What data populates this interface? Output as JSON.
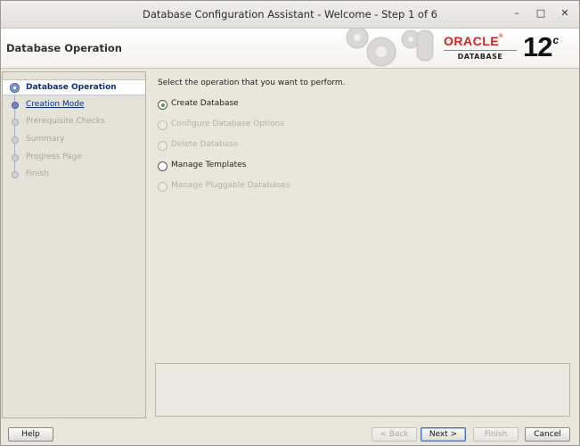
{
  "window": {
    "title": "Database Configuration Assistant - Welcome - Step 1 of 6",
    "controls": {
      "minimize": "–",
      "maximize": "□",
      "close": "✕"
    }
  },
  "header": {
    "title": "Database Operation",
    "brand": {
      "word": "ORACLE",
      "reg": "®",
      "sub": "DATABASE",
      "version": "12",
      "version_suffix": "c"
    }
  },
  "nav": {
    "items": [
      {
        "label": "Database Operation",
        "state": "active"
      },
      {
        "label": "Creation Mode",
        "state": "link"
      },
      {
        "label": "Prerequisite Checks",
        "state": "disabled"
      },
      {
        "label": "Summary",
        "state": "disabled"
      },
      {
        "label": "Progress Page",
        "state": "disabled"
      },
      {
        "label": "Finish",
        "state": "disabled"
      }
    ]
  },
  "main": {
    "prompt": "Select the operation that you want to perform.",
    "options": [
      {
        "label": "Create Database",
        "selected": true,
        "enabled": true
      },
      {
        "label": "Configure Database Options",
        "selected": false,
        "enabled": false
      },
      {
        "label": "Delete Database",
        "selected": false,
        "enabled": false
      },
      {
        "label": "Manage Templates",
        "selected": false,
        "enabled": true
      },
      {
        "label": "Manage Pluggable Databases",
        "selected": false,
        "enabled": false
      }
    ]
  },
  "footer": {
    "help": "Help",
    "back": "< Back",
    "next": "Next >",
    "finish": "Finish",
    "cancel": "Cancel"
  },
  "colors": {
    "oracle_red": "#d2231e",
    "nav_link": "#0b2f7a",
    "selected_radio": "#5a9a4a"
  }
}
